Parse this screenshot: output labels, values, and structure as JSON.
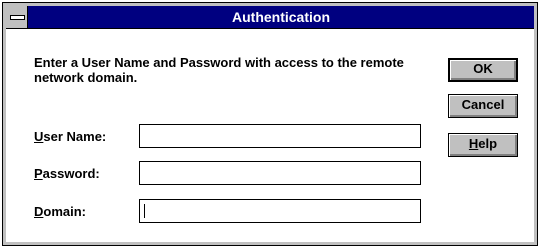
{
  "window": {
    "title": "Authentication"
  },
  "prompt": "Enter a User Name and Password with access to the remote network domain.",
  "fields": {
    "username": {
      "label_hotkey": "U",
      "label_rest": "ser Name:",
      "value": ""
    },
    "password": {
      "label_hotkey": "P",
      "label_rest": "assword:",
      "value": ""
    },
    "domain": {
      "label_hotkey": "D",
      "label_rest": "omain:",
      "value": ""
    }
  },
  "buttons": {
    "ok": "OK",
    "cancel": "Cancel",
    "help_hotkey": "H",
    "help_rest": "elp"
  }
}
